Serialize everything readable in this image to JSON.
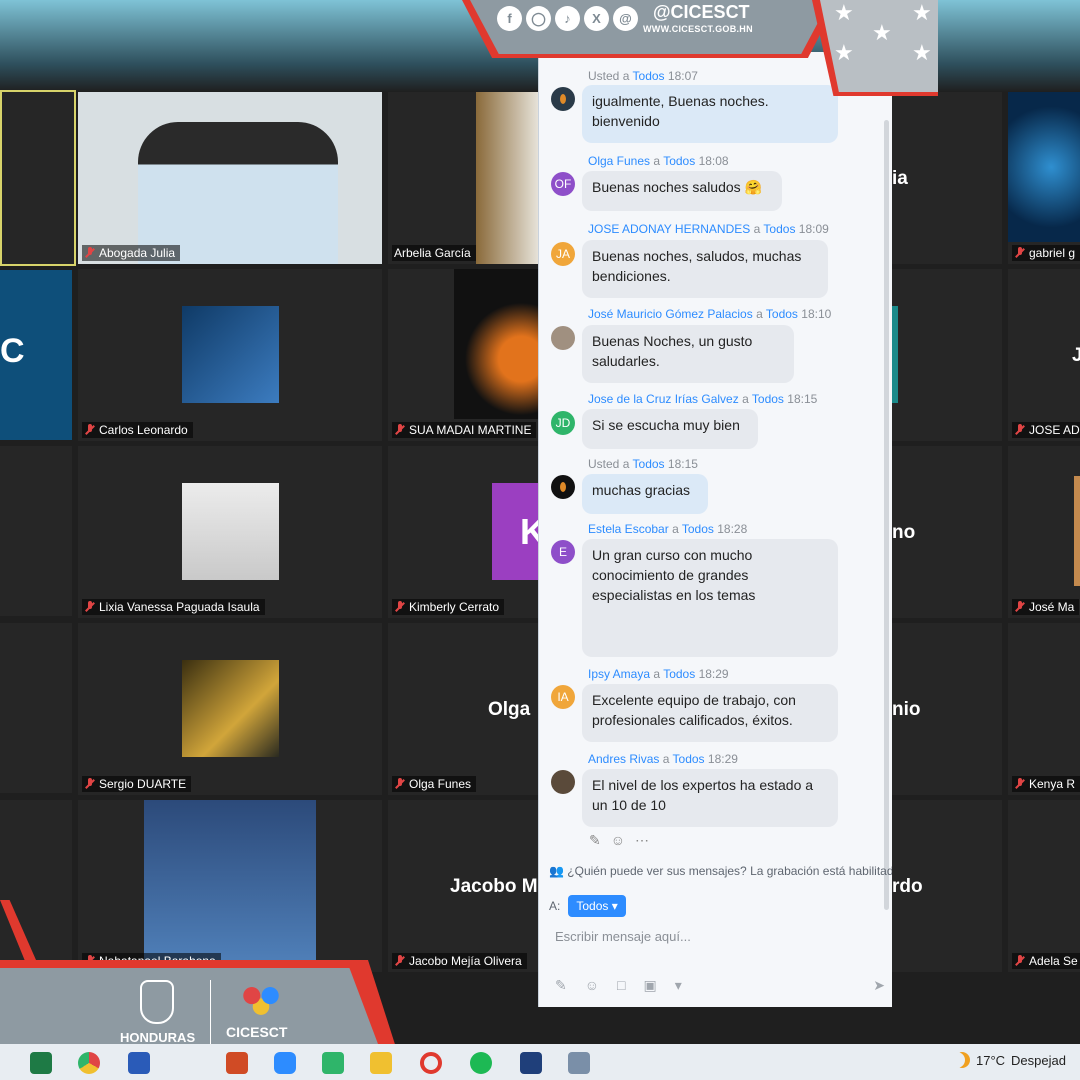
{
  "branding": {
    "handle": "@CICESCT",
    "website": "WWW.CICESCT.GOB.HN",
    "social_icons": [
      "facebook-icon",
      "instagram-icon",
      "tiktok-icon",
      "x-icon",
      "threads-icon"
    ],
    "honduras_label": "HONDURAS",
    "org_label": "CICESCT"
  },
  "participants": {
    "abogada": "Abogada Julia",
    "arbelia": "Arbelia García",
    "gabriel": "gabriel g",
    "carlos": "Carlos Leonardo",
    "sua": "SUA MADAI MARTINE",
    "jose_ad": "JOSE AD",
    "lixia": "Lixia Vanessa Paguada Isaula",
    "kimberly": "Kimberly Cerrato",
    "jose_ma": "José Ma",
    "sergio": "Sergio DUARTE",
    "olga": "Olga Funes",
    "kenya": "Kenya R",
    "nahatanael": "Nahatanael Barahona",
    "jacobo": "Jacobo Mejía Olivera",
    "adela": "Adela Se"
  },
  "big_names": {
    "olga": "Olga",
    "jacobo": "Jacobo M",
    "partial_ia": "ia",
    "partial_no": "no",
    "partial_nio": "nio",
    "partial_rdo": "rdo",
    "partial_j": "J",
    "partial_c": "C",
    "kimberly_initial": "K"
  },
  "chat": {
    "messages": [
      {
        "sender": "Usted",
        "to": "Todos",
        "time": "18:07",
        "text_lines": [
          "igualmente, Buenas noches.",
          "bienvenido"
        ]
      },
      {
        "sender": "Olga Funes",
        "to": "Todos",
        "time": "18:08",
        "initials": "OF",
        "text_lines": [
          "Buenas noches saludos 🤗"
        ]
      },
      {
        "sender": "JOSE ADONAY HERNANDES",
        "to": "Todos",
        "time": "18:09",
        "initials": "JA",
        "text_lines": [
          "Buenas noches, saludos, muchas",
          "bendiciones."
        ]
      },
      {
        "sender": "José Mauricio Gómez Palacios",
        "to": "Todos",
        "time": "18:10",
        "text_lines": [
          "Buenas Noches, un gusto",
          "saludarles."
        ]
      },
      {
        "sender": "Jose de la Cruz Irías Galvez",
        "to": "Todos",
        "time": "18:15",
        "initials": "JD",
        "text_lines": [
          "Si se escucha muy bien"
        ]
      },
      {
        "sender": "Usted",
        "to": "Todos",
        "time": "18:15",
        "text_lines": [
          "muchas gracias"
        ]
      },
      {
        "sender": "Estela Escobar",
        "to": "Todos",
        "time": "18:28",
        "initials": "E",
        "text_lines": [
          "Un gran curso con mucho",
          "conocimiento  de grandes",
          "especialistas en los temas"
        ]
      },
      {
        "sender": "Ipsy Amaya",
        "to": "Todos",
        "time": "18:29",
        "initials": "IA",
        "text_lines": [
          "Excelente equipo de trabajo, con",
          "profesionales calificados, éxitos."
        ]
      },
      {
        "sender": "Andres Rivas",
        "to": "Todos",
        "time": "18:29",
        "text_lines": [
          "El nivel de los expertos ha estado a",
          "un 10 de 10"
        ]
      }
    ],
    "a_word": "a",
    "privacy_notice": "¿Quién puede ver sus mensajes? La grabación está habilitada",
    "to_label": "A:",
    "to_value": "Todos",
    "placeholder": "Escribir mensaje aquí..."
  },
  "taskbar": {
    "temperature": "17°C",
    "weather": "Despejad"
  },
  "colors": {
    "accent_blue": "#2d8cff",
    "brand_red": "#e0392e",
    "brand_grey": "#8e9aa2"
  }
}
